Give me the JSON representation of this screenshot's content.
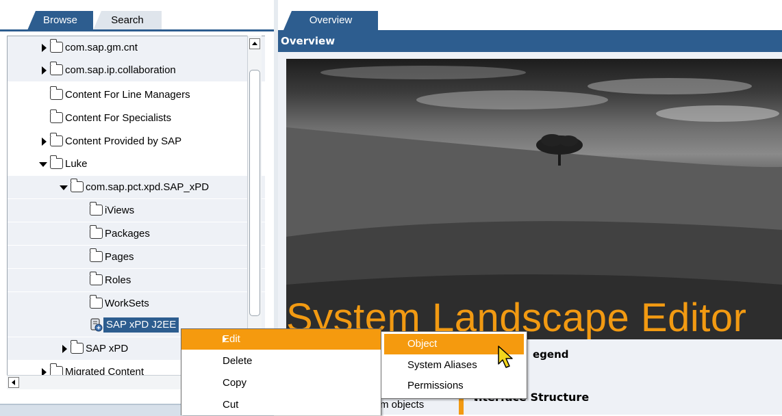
{
  "left_panel": {
    "tabs": [
      {
        "label": "Browse",
        "active": true
      },
      {
        "label": "Search",
        "active": false
      }
    ],
    "tree": [
      {
        "label": "com.sap.gm.cnt",
        "expander": "collapsed",
        "indent": 0,
        "icon": "folder-icon"
      },
      {
        "label": "com.sap.ip.collaboration",
        "expander": "collapsed",
        "indent": 0,
        "icon": "folder-icon"
      },
      {
        "label": "Content For Line Managers",
        "expander": "none",
        "indent": 0,
        "icon": "folder-icon"
      },
      {
        "label": "Content For Specialists",
        "expander": "none",
        "indent": 0,
        "icon": "folder-icon"
      },
      {
        "label": "Content Provided by SAP",
        "expander": "collapsed",
        "indent": 0,
        "icon": "folder-icon"
      },
      {
        "label": "Luke",
        "expander": "expanded",
        "indent": 0,
        "icon": "folder-icon"
      },
      {
        "label": "com.sap.pct.xpd.SAP_xPD",
        "expander": "expanded",
        "indent": 1,
        "icon": "folder-icon"
      },
      {
        "label": "iViews",
        "expander": "none",
        "indent": 2,
        "icon": "folder-icon"
      },
      {
        "label": "Packages",
        "expander": "none",
        "indent": 2,
        "icon": "folder-icon"
      },
      {
        "label": "Pages",
        "expander": "none",
        "indent": 2,
        "icon": "folder-icon"
      },
      {
        "label": "Roles",
        "expander": "none",
        "indent": 2,
        "icon": "folder-icon"
      },
      {
        "label": "WorkSets",
        "expander": "none",
        "indent": 2,
        "icon": "folder-icon"
      },
      {
        "label": "SAP xPD J2EE",
        "expander": "none",
        "indent": 2,
        "icon": "system-icon",
        "selected": true
      },
      {
        "label": "SAP xPD",
        "expander": "collapsed",
        "indent": 1,
        "icon": "folder-icon"
      },
      {
        "label": "Migrated Content",
        "expander": "collapsed",
        "indent": 1,
        "icon": "folder-icon"
      }
    ]
  },
  "right_panel": {
    "tab_label": "Overview",
    "header_title": "Overview",
    "hero_title": "System Landscape Editor",
    "legend_title": "egend",
    "interface_title": "nterface Structure",
    "system_objects_text": "m objects"
  },
  "context_menu": {
    "items": [
      {
        "label": "Edit",
        "highlighted": true,
        "submenu": true
      },
      {
        "label": "Delete"
      },
      {
        "label": "Copy"
      },
      {
        "label": "Cut"
      }
    ]
  },
  "submenu": {
    "items": [
      {
        "label": "Object",
        "highlighted": true
      },
      {
        "label": "System Aliases"
      },
      {
        "label": "Permissions"
      }
    ]
  },
  "colors": {
    "accent_blue": "#2d5d8f",
    "menu_highlight": "#f59a0e",
    "hero_title": "#f29a12"
  }
}
